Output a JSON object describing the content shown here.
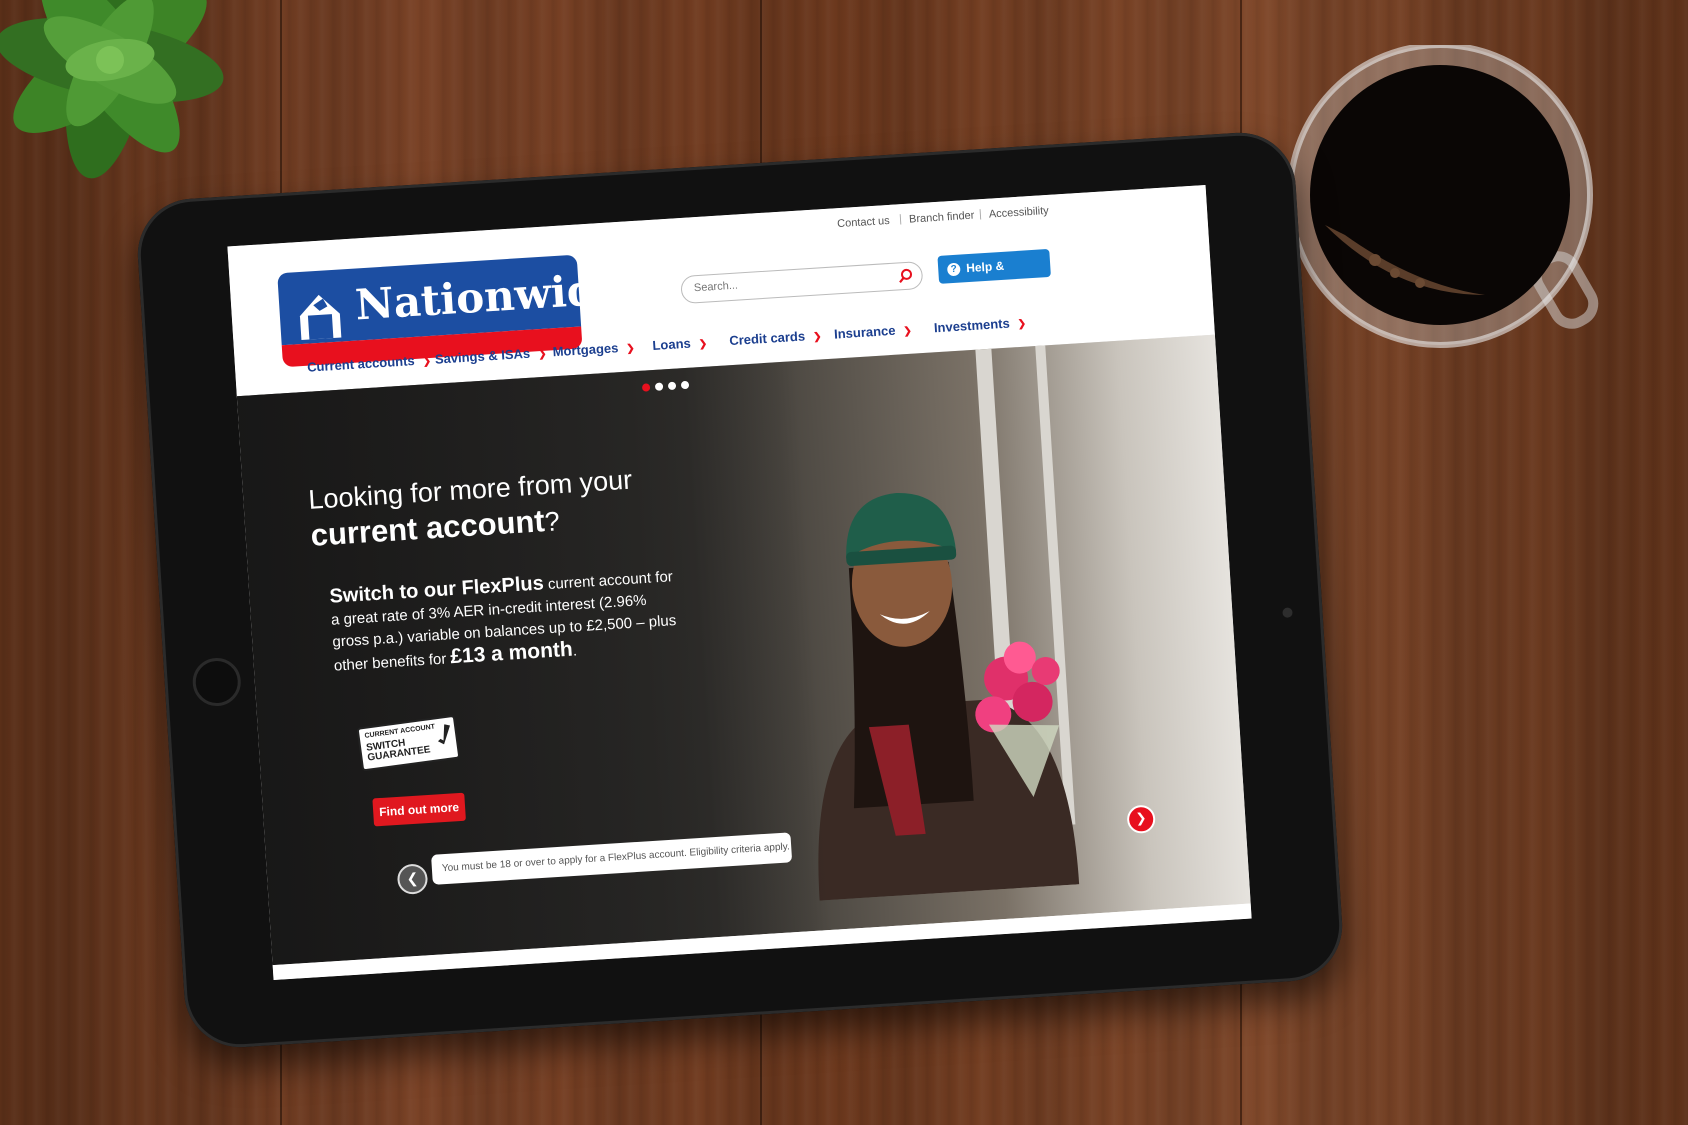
{
  "header": {
    "logo_text": "Nationwide",
    "utility_links": [
      "Contact us",
      "Branch finder",
      "Accessibility"
    ],
    "search_placeholder": "Search...",
    "help_label": "Help & support",
    "nav": [
      "Current accounts",
      "Savings & ISAs",
      "Mortgages",
      "Loans",
      "Credit cards",
      "Insurance",
      "Investments"
    ]
  },
  "hero": {
    "headline_line1": "Looking for more from your",
    "headline_line2_bold": "current account",
    "headline_q": "?",
    "lead_bold": "Switch to our FlexPlus",
    "lead_rest": " current account for a great rate of 3% AER in-credit interest (2.96% gross p.a.) variable on balances up to £2,500 – plus other benefits for ",
    "price_bold": "£13 a month",
    "price_end": ".",
    "badge_line1": "CURRENT ACCOUNT",
    "badge_line2": "SWITCH",
    "badge_line3": "GUARANTEE",
    "cta_label": "Find out more",
    "disclaimer": "You must be 18 or over to apply for a FlexPlus account. Eligibility criteria apply.",
    "slides": 4,
    "active_slide": 1
  },
  "colors": {
    "brand_blue": "#1c4ea2",
    "brand_red": "#e8101e",
    "help_blue": "#1a7fd0"
  },
  "icons": [
    "search-icon",
    "help-icon",
    "chevron-down-icon",
    "prev-arrow-icon",
    "next-arrow-icon",
    "logo-house-icon"
  ]
}
